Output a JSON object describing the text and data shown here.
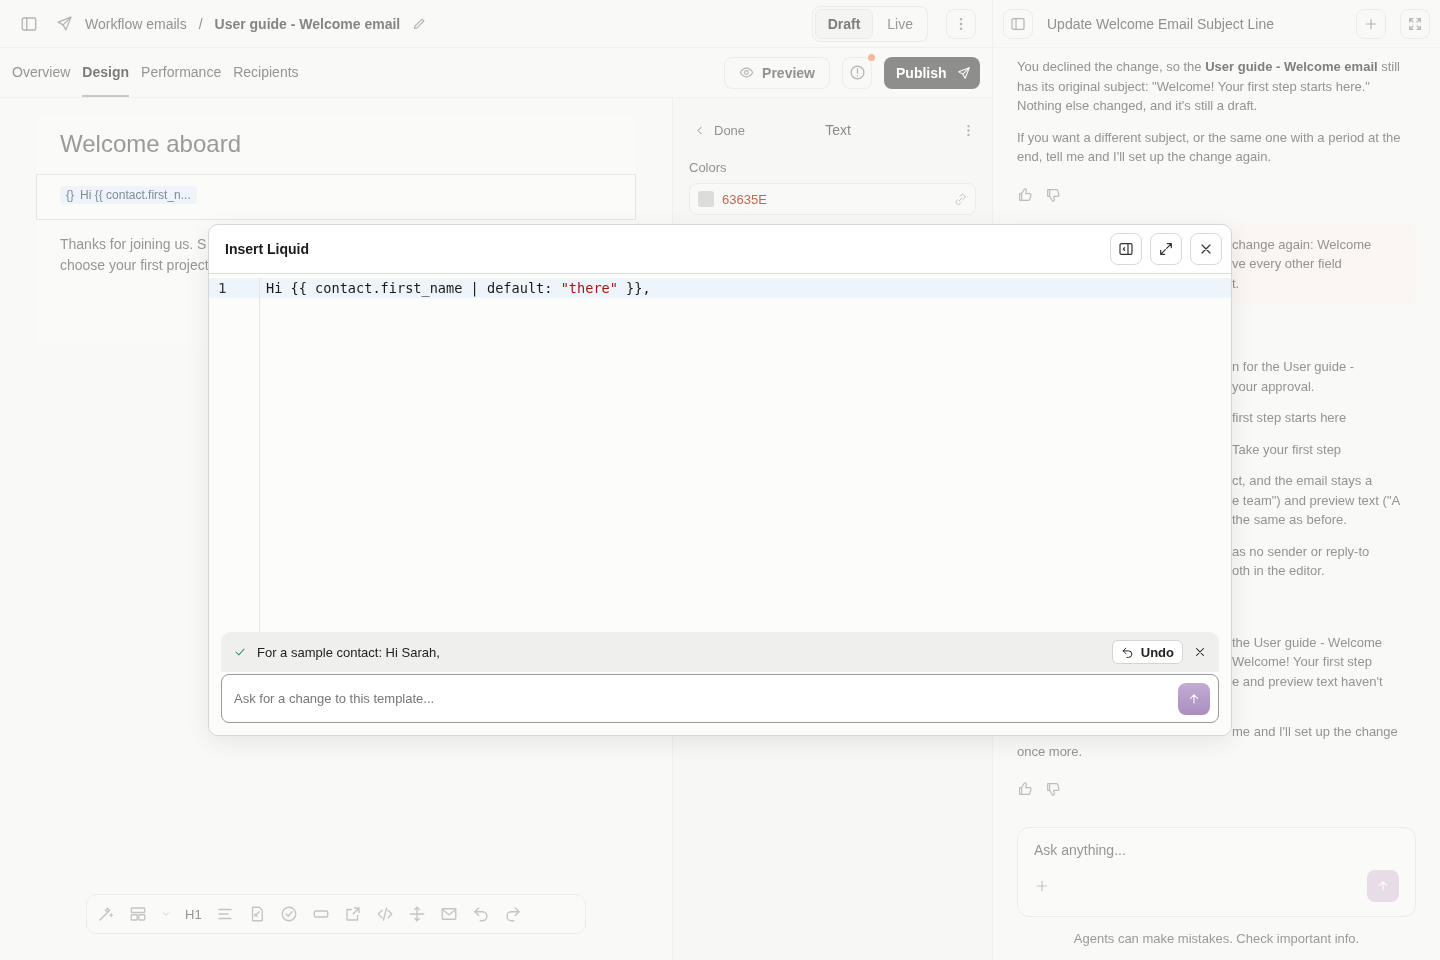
{
  "header": {
    "breadcrumb": [
      {
        "label": "Workflow emails"
      },
      {
        "label": "User guide - Welcome email"
      }
    ],
    "separator": "/",
    "status": [
      {
        "label": "Draft",
        "selected": true
      },
      {
        "label": "Live",
        "selected": false
      }
    ]
  },
  "tabs": [
    {
      "label": "Overview",
      "selected": false
    },
    {
      "label": "Design",
      "selected": true
    },
    {
      "label": "Performance",
      "selected": false
    },
    {
      "label": "Recipients",
      "selected": false
    }
  ],
  "actions": {
    "preview": "Preview",
    "publish": "Publish",
    "alert": true
  },
  "email": {
    "heading": "Welcome aboard",
    "chip_icon": "{}",
    "chip": "Hi {{ contact.first_n...",
    "body_lines": [
      "Thanks for joining us. S",
      "choose your first project"
    ]
  },
  "properties": {
    "back": "Done",
    "title": "Text",
    "section": "Colors",
    "color_value": "63635E"
  },
  "toolbar": {
    "heading_label": "H1"
  },
  "chat": {
    "title": "Update Welcome Email Subject Line",
    "messages": [
      {
        "kind": "reply",
        "feedback": true,
        "paragraphs": [
          {
            "kind": "full",
            "text": "You declined the change, so the **User guide - Welcome email** still has its original subject: \"Welcome! Your first step starts here.\" Nothing else changed, and it's still a draft."
          },
          {
            "kind": "full",
            "text": "If you want a different subject, or the same one with a period at the end, tell me and I'll set up the change again."
          }
        ]
      },
      {
        "kind": "request",
        "feedback": false,
        "paragraphs": [
          {
            "kind": "clipped",
            "lines": [
              "change again: Welcome",
              "ve every other field",
              "t."
            ]
          }
        ]
      },
      {
        "kind": "reply",
        "feedback": false,
        "paragraphs": [
          {
            "kind": "clipped",
            "lines": [
              "n for the User guide -",
              "your approval."
            ]
          },
          {
            "kind": "clipped",
            "lines": [
              "first step starts here"
            ]
          },
          {
            "kind": "clipped",
            "lines": [
              "Take your first step"
            ]
          },
          {
            "kind": "clipped",
            "lines": [
              "ct, and the email stays a",
              "e team\") and preview text (\"A",
              "the same as before."
            ]
          },
          {
            "kind": "clipped",
            "lines": [
              "as no sender or reply-to",
              "oth in the editor."
            ]
          }
        ]
      },
      {
        "kind": "reply",
        "feedback": true,
        "paragraphs": [
          {
            "kind": "clipped",
            "lines": [
              "the User guide - Welcome",
              "Welcome! Your first step",
              "e and preview text haven't"
            ]
          },
          {
            "kind": "clipped",
            "lines": [
              "me and I'll set up the change"
            ],
            "tail": "once more."
          }
        ]
      }
    ],
    "composer": {
      "placeholder": "Ask anything..."
    },
    "disclaimer": "Agents can make mistakes. Check important info."
  },
  "modal": {
    "title": "Insert Liquid",
    "code_lines": [
      {
        "number": "1",
        "active": true,
        "tokens": [
          {
            "kind": "plain",
            "text": "Hi {{ contact.first_name | default: "
          },
          {
            "kind": "string",
            "text": "\"there\""
          },
          {
            "kind": "plain",
            "text": " }},"
          }
        ]
      }
    ],
    "result": {
      "text": "For a sample contact: Hi Sarah,",
      "undo": "Undo"
    },
    "prompt": {
      "placeholder": "Ask for a change to this template..."
    }
  }
}
